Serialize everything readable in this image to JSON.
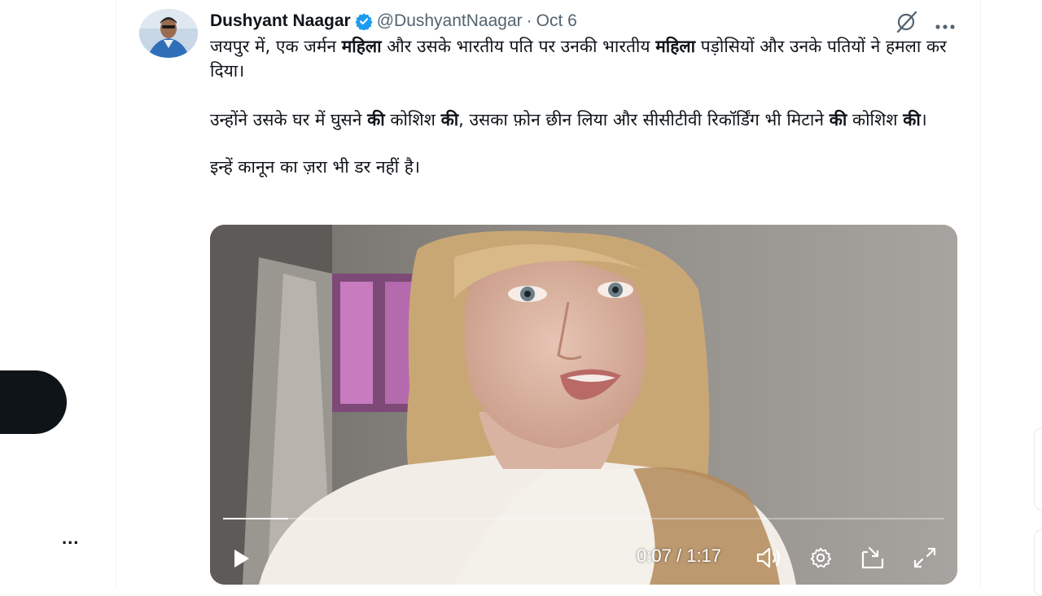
{
  "tweet": {
    "author_name": "Dushyant Naagar",
    "handle": "@DushyantNaagar",
    "separator": "·",
    "date": "Oct 6",
    "text": {
      "line1_a": "जयपुर में, एक जर्मन ",
      "line1_b": "महिला",
      "line1_c": " और उसके भारतीय पति पर उनकी भारतीय ",
      "line1_d": "महिला",
      "line1_e": " पड़ोसियों और उनके पतियों ने हमला कर दिया।",
      "p2_a": "उन्होंने उसके घर में घुसने ",
      "p2_b": "की",
      "p2_c": " कोशिश ",
      "p2_d": "की",
      "p2_e": ", उसका फ़ोन छीन लिया और सीसीटीवी रिकॉर्डिंग भी मिटाने ",
      "p2_f": "की",
      "p2_g": " कोशिश ",
      "p2_h": "की",
      "p2_i": "।",
      "p3": "इन्हें कानून का ज़रा भी डर नहीं है।"
    }
  },
  "video": {
    "current_time": "0:07",
    "time_separator": "/",
    "duration": "1:17",
    "progress": 0.09
  },
  "sidebar": {
    "more_label": "..."
  },
  "icons": {
    "verified": "verified-badge-icon",
    "grok": "grok-icon",
    "more": "more-icon",
    "play": "play-icon",
    "volume": "volume-icon",
    "settings": "gear-icon",
    "pip": "picture-in-picture-icon",
    "fullscreen": "fullscreen-icon"
  },
  "colors": {
    "verified_blue": "#1d9bf0",
    "secondary_text": "#536471",
    "primary_text": "#0f1419"
  }
}
